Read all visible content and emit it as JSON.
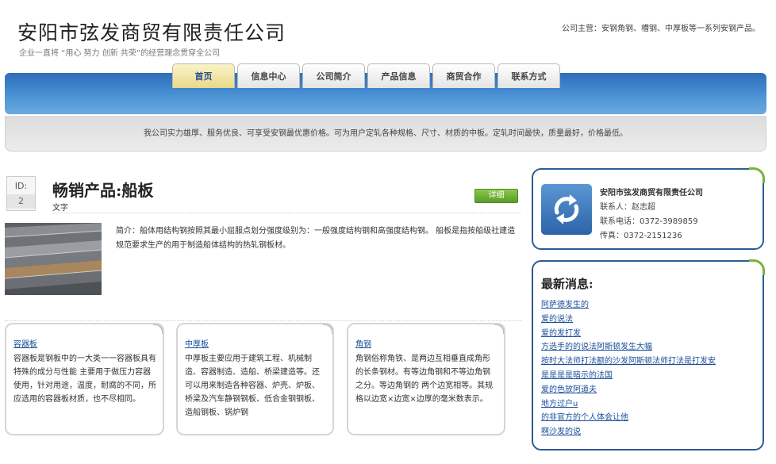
{
  "header": {
    "title": "安阳市弦发商贸有限责任公司",
    "slogan": "企业一直将 “用心 努力 创新 共荣”的经营理念贯穿全公司",
    "business": "公司主营：安钢角钢、槽钢、中厚板等一系列安钢产品。"
  },
  "nav": {
    "items": [
      "首页",
      "信息中心",
      "公司简介",
      "产品信息",
      "商贸合作",
      "联系方式"
    ],
    "active_index": 0
  },
  "notice": "我公司实力雄厚、服务优良、可享受安钢最优惠价格。可为用户定轧各种规格、尺寸、材质的中板。定轧时间最快，质量最好，价格最低。",
  "product": {
    "id_label": "ID:",
    "id_value": "2",
    "title": "畅销产品:船板",
    "subtitle": "文字",
    "detail_label": "详细",
    "description": "简介：船体用结构钢按照其最小屈服点划分强度级别为：一般强度结构钢和高强度结构钢。 船板是指按船级社建造规范要求生产的用于制造船体结构的热轧钢板材。"
  },
  "cards": [
    {
      "title": "容器板",
      "text": "容器板是钢板中的一大类一一容器板具有特殊的成分与性能 主要用于做压力容器使用，针对用途，温度，耐腐的不同，所应选用的容器板材质，也不尽相同。"
    },
    {
      "title": "中厚板",
      "text": "中厚板主要应用于建筑工程、机械制造、容器制造、造船、桥梁建造等。还可以用来制造各种容器、炉壳、炉板、桥梁及汽车静钢钢板、低合金钢钢板、造船钢板、锅炉钢"
    },
    {
      "title": "角钢",
      "text": "角钢俗称角铁、是两边互相垂直成角形的长条钢材。有等边角钢和不等边角钢之分。等边角钢的 两个边宽相等。其规格以边宽×边宽×边厚的毫米数表示。"
    }
  ],
  "contact": {
    "company": "安阳市弦发商贸有限责任公司",
    "person": "联系人：赵志超",
    "phone": "联系电话：0372-3989859",
    "fax": "传真：0372-2151236"
  },
  "news": {
    "title": "最新消息:",
    "items": [
      "阿萨德发生的",
      "爱的说法",
      "爱的发打发",
      "方选手的的说法阿斯顿发生大幅",
      "按时大法师打法额的沙发阿斯顿法师打法是打发安",
      "是是是是暗示的法国",
      "爱的色放阿道夫",
      "地方过户u",
      "的非官方的个人体会让他",
      "啊沙发的说"
    ]
  },
  "colors": {
    "nav_blue": "#3e85cc",
    "frame_blue": "#2a5d95",
    "accent_green": "#7ab33c",
    "link_blue": "#1a4e9a"
  }
}
